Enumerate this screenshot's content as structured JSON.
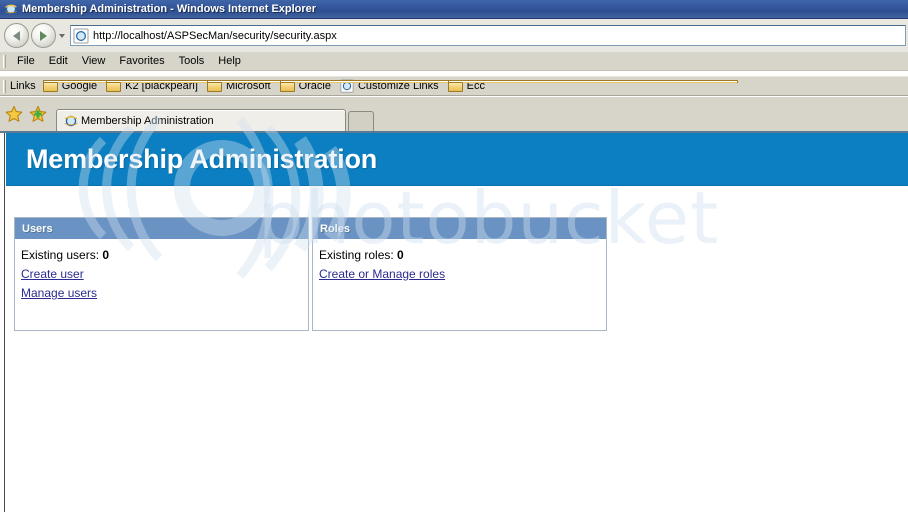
{
  "window": {
    "title": "Membership Administration - Windows Internet Explorer",
    "app_icon": "internet-explorer-icon"
  },
  "navigation": {
    "back_icon": "back-arrow-icon",
    "forward_icon": "forward-arrow-icon",
    "recent_pages_icon": "chevron-down-icon",
    "address": {
      "icon": "page-icon",
      "value": "http://localhost/ASPSecMan/security/security.aspx",
      "placeholder": "http://"
    }
  },
  "menubar": {
    "items": [
      {
        "label": "File",
        "accel": "F"
      },
      {
        "label": "Edit",
        "accel": "E"
      },
      {
        "label": "View",
        "accel": "V"
      },
      {
        "label": "Favorites",
        "accel": "a"
      },
      {
        "label": "Tools",
        "accel": "T"
      },
      {
        "label": "Help",
        "accel": "H"
      }
    ]
  },
  "linksbar": {
    "label": "Links",
    "items": [
      {
        "label": "Google",
        "icon": "folder-icon"
      },
      {
        "label": "K2 [blackpearl]",
        "icon": "folder-icon"
      },
      {
        "label": "Microsoft",
        "icon": "folder-icon"
      },
      {
        "label": "Oracle",
        "icon": "folder-icon"
      },
      {
        "label": "Customize Links",
        "icon": "internet-explorer-icon"
      },
      {
        "label": "Ecc",
        "icon": "folder-icon"
      }
    ]
  },
  "tabbar": {
    "favorites_icon": "favorites-star-icon",
    "add_favorite_icon": "add-to-favorites-icon",
    "tabs": [
      {
        "label": "Membership Administration",
        "icon": "internet-explorer-icon",
        "active": true
      }
    ],
    "new_tab_label": ""
  },
  "page": {
    "banner_title": "Membership Administration",
    "panels": [
      {
        "id": "users",
        "header": "Users",
        "count_label": "Existing users:",
        "count_value": "0",
        "links": [
          {
            "label": "Create user"
          },
          {
            "label": "Manage users"
          }
        ]
      },
      {
        "id": "roles",
        "header": "Roles",
        "count_label": "Existing roles:",
        "count_value": "0",
        "links": [
          {
            "label": "Create or Manage roles"
          }
        ]
      }
    ]
  },
  "watermark": {
    "text": "photobucket",
    "logo": "photobucket-swirl-logo"
  },
  "colors": {
    "titlebar": "#33559a",
    "banner_blue": "#0b7fc1",
    "panel_header_blue": "#6a93c3",
    "link_blue": "#2b2b8f",
    "chrome_gray": "#d7d5ca",
    "watermark": "#7ea6cf"
  }
}
